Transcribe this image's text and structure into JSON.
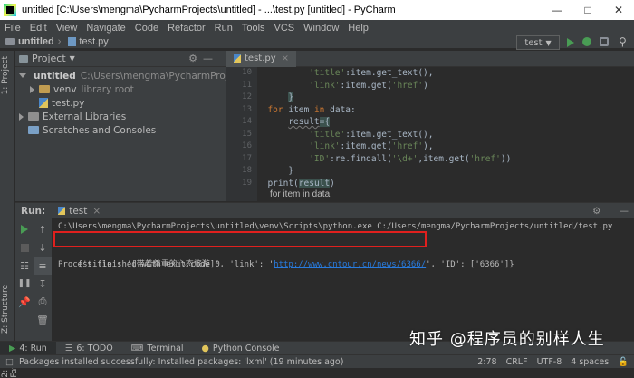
{
  "window": {
    "title": "untitled [C:\\Users\\mengma\\PycharmProjects\\untitled] - ...\\test.py [untitled] - PyCharm"
  },
  "menu": [
    "File",
    "Edit",
    "View",
    "Navigate",
    "Code",
    "Refactor",
    "Run",
    "Tools",
    "VCS",
    "Window",
    "Help"
  ],
  "navbar": {
    "project": "untitled",
    "file": "test.py",
    "run_config": "test"
  },
  "left_strip": {
    "project_tab": "1: Project",
    "structure_tab": "Z: Structure",
    "favorites_tab": "2: Favorites"
  },
  "project_panel": {
    "header": "Project",
    "root_name": "untitled",
    "root_path": "C:\\Users\\mengma\\PycharmProjects\\untitle",
    "venv_name": "venv",
    "venv_note": "library root",
    "file": "test.py",
    "external": "External Libraries",
    "scratches": "Scratches and Consoles"
  },
  "editor": {
    "tab": "test.py",
    "line_numbers": [
      "10",
      "11",
      "12",
      "13",
      "14",
      "15",
      "16",
      "17",
      "18",
      "19"
    ],
    "breadcrumb": "for item in data"
  },
  "run_panel": {
    "label": "Run:",
    "tab": "test",
    "cmd": "C:\\Users\\mengma\\PycharmProjects\\untitled\\venv\\Scripts\\python.exe C:/Users/mengma/PycharmProjects/untitled/test.py",
    "out_prefix": "{'title': '[带着尊重的心态旅游]', 'link': '",
    "out_link": "http://www.cntour.cn/news/6366/",
    "out_suffix": "', 'ID': ['6366']}",
    "finish": "Process finished with exit code 0"
  },
  "bottom_tabs": [
    "4: Run",
    "6: TODO",
    "Terminal",
    "Python Console"
  ],
  "status": {
    "message": "Packages installed successfully: Installed packages: 'lxml' (19 minutes ago)",
    "position": "2:78",
    "line_sep": "CRLF",
    "encoding": "UTF-8",
    "indent": "4 spaces"
  },
  "watermark": "知乎 @程序员的别样人生",
  "colors": {
    "highlight_box": "#e0201e",
    "link": "#287bde",
    "run_green": "#499c54"
  }
}
